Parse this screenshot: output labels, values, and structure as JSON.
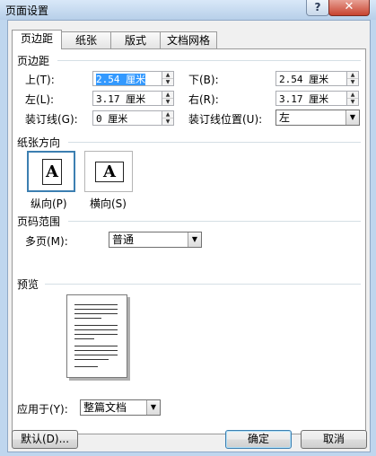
{
  "window": {
    "title": "页面设置",
    "help_glyph": "?",
    "close_glyph": "✕"
  },
  "tabs": [
    {
      "label": "页边距",
      "active": true
    },
    {
      "label": "纸张",
      "active": false
    },
    {
      "label": "版式",
      "active": false
    },
    {
      "label": "文档网格",
      "active": false
    }
  ],
  "margins": {
    "section_label": "页边距",
    "top": {
      "label": "上(T):",
      "value": "2.54 厘米"
    },
    "bottom": {
      "label": "下(B):",
      "value": "2.54 厘米"
    },
    "left": {
      "label": "左(L):",
      "value": "3.17 厘米"
    },
    "right": {
      "label": "右(R):",
      "value": "3.17 厘米"
    },
    "gutter": {
      "label": "装订线(G):",
      "value": "0 厘米"
    },
    "gutter_pos": {
      "label": "装订线位置(U):",
      "value": "左"
    }
  },
  "orientation": {
    "section_label": "纸张方向",
    "portrait": {
      "label": "纵向(P)",
      "glyph": "A",
      "selected": true
    },
    "landscape": {
      "label": "横向(S)",
      "glyph": "A",
      "selected": false
    }
  },
  "pages": {
    "section_label": "页码范围",
    "multiple_label": "多页(M):",
    "multiple_value": "普通"
  },
  "preview": {
    "section_label": "预览"
  },
  "apply": {
    "label": "应用于(Y):",
    "value": "整篇文档"
  },
  "buttons": {
    "default": "默认(D)...",
    "ok": "确定",
    "cancel": "取消"
  },
  "icons": {
    "spin_up": "▲",
    "spin_down": "▼",
    "dropdown": "▼"
  }
}
